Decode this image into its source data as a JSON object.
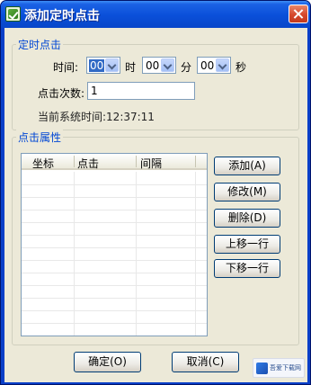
{
  "window": {
    "title": "添加定时点击"
  },
  "timer_group": {
    "title": "定时点击",
    "time_label": "时间:",
    "hour_value": "00",
    "hour_unit": "时",
    "minute_value": "00",
    "minute_unit": "分",
    "second_value": "00",
    "second_unit": "秒",
    "click_count_label": "点击次数:",
    "click_count_value": "1",
    "system_time_label": "当前系统时间:12:37:11"
  },
  "props_group": {
    "title": "点击属性",
    "columns": [
      "坐标",
      "点击",
      "间隔"
    ],
    "buttons": {
      "add": "添加(A)",
      "modify": "修改(M)",
      "delete": "删除(D)",
      "move_up": "上移一行",
      "move_down": "下移一行"
    }
  },
  "footer": {
    "ok": "确定(O)",
    "cancel": "取消(C)"
  },
  "watermark": {
    "text": "吾爱下载网"
  }
}
